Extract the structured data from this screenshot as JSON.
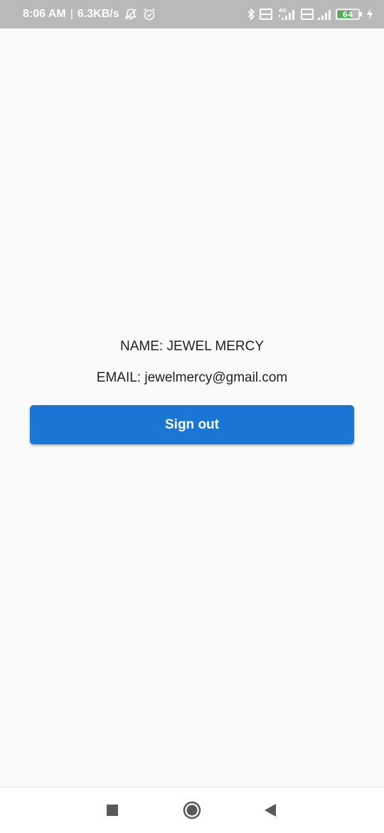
{
  "status_bar": {
    "time": "8:06 AM",
    "separator": "|",
    "network_speed": "6.3KB/s",
    "network_type": "4G",
    "battery_level": "64",
    "icons": [
      "notifications-off-icon",
      "alarm-icon",
      "bluetooth-icon",
      "volte-icon",
      "signal-icon",
      "volte-icon",
      "signal-icon",
      "battery-icon",
      "charging-icon"
    ]
  },
  "profile": {
    "name_text": "NAME: JEWEL MERCY",
    "email_text": "EMAIL: jewelmercy@gmail.com"
  },
  "actions": {
    "signout_label": "Sign out"
  },
  "navigation": {
    "items": [
      "recent-apps-icon",
      "home-icon",
      "back-icon"
    ]
  },
  "colors": {
    "status_bar_bg": "#b9b9b9",
    "page_bg": "#fafafa",
    "button_bg": "#1976d2",
    "button_text": "#ffffff",
    "body_text": "#212121",
    "nav_icon": "#595959",
    "battery_fill": "#4caf50"
  }
}
